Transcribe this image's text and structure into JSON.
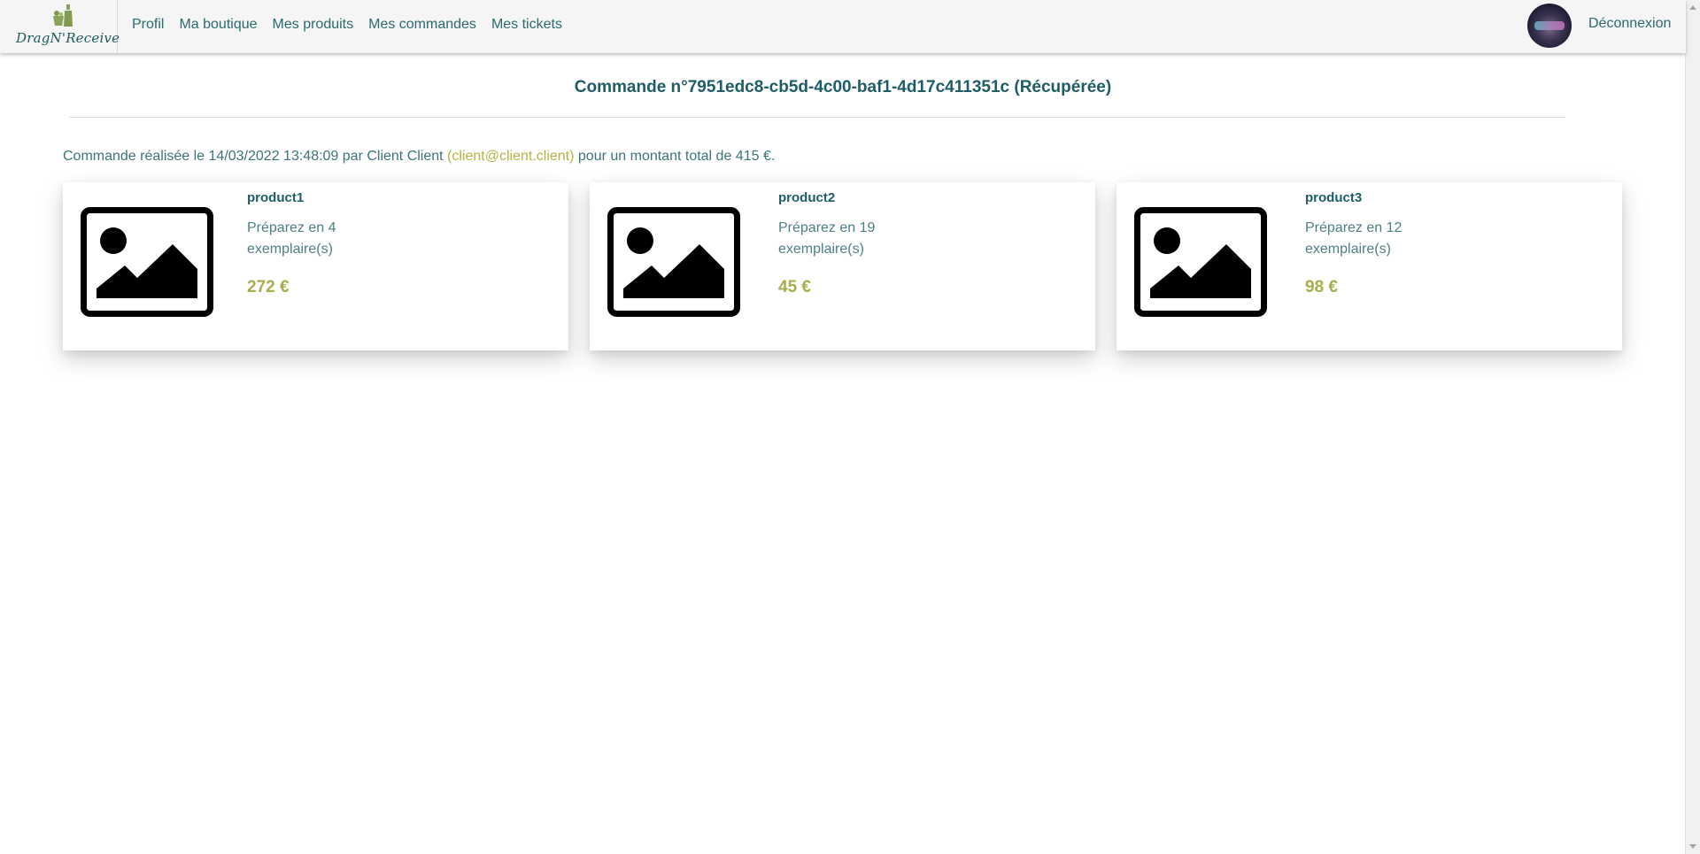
{
  "brand": {
    "name": "DragN'Receive",
    "logo_icon": "bottle-and-basket-icon"
  },
  "nav": {
    "links": [
      {
        "label": "Profil"
      },
      {
        "label": "Ma boutique"
      },
      {
        "label": "Mes produits"
      },
      {
        "label": "Mes commandes"
      },
      {
        "label": "Mes tickets"
      }
    ],
    "logout_label": "Déconnexion"
  },
  "order": {
    "title": "Commande n°7951edc8-cb5d-4c00-baf1-4d17c411351c (Récupérée)",
    "summary_prefix": "Commande réalisée le 14/03/2022 13:48:09 par Client Client ",
    "summary_email": "(client@client.client)",
    "summary_suffix": " pour un montant total de 415 €."
  },
  "products": [
    {
      "name": "product1",
      "quantity_text": "Préparez en 4 exemplaire(s)",
      "price": "272 €",
      "image_icon": "image-placeholder-icon"
    },
    {
      "name": "product2",
      "quantity_text": "Préparez en 19 exemplaire(s)",
      "price": "45 €",
      "image_icon": "image-placeholder-icon"
    },
    {
      "name": "product3",
      "quantity_text": "Préparez en 12 exemplaire(s)",
      "price": "98 €",
      "image_icon": "image-placeholder-icon"
    }
  ],
  "colors": {
    "primary": "#1e5d66",
    "link": "#2a6b70",
    "accent": "#a9ad4c",
    "navbar_bg": "#f5f5f5"
  }
}
